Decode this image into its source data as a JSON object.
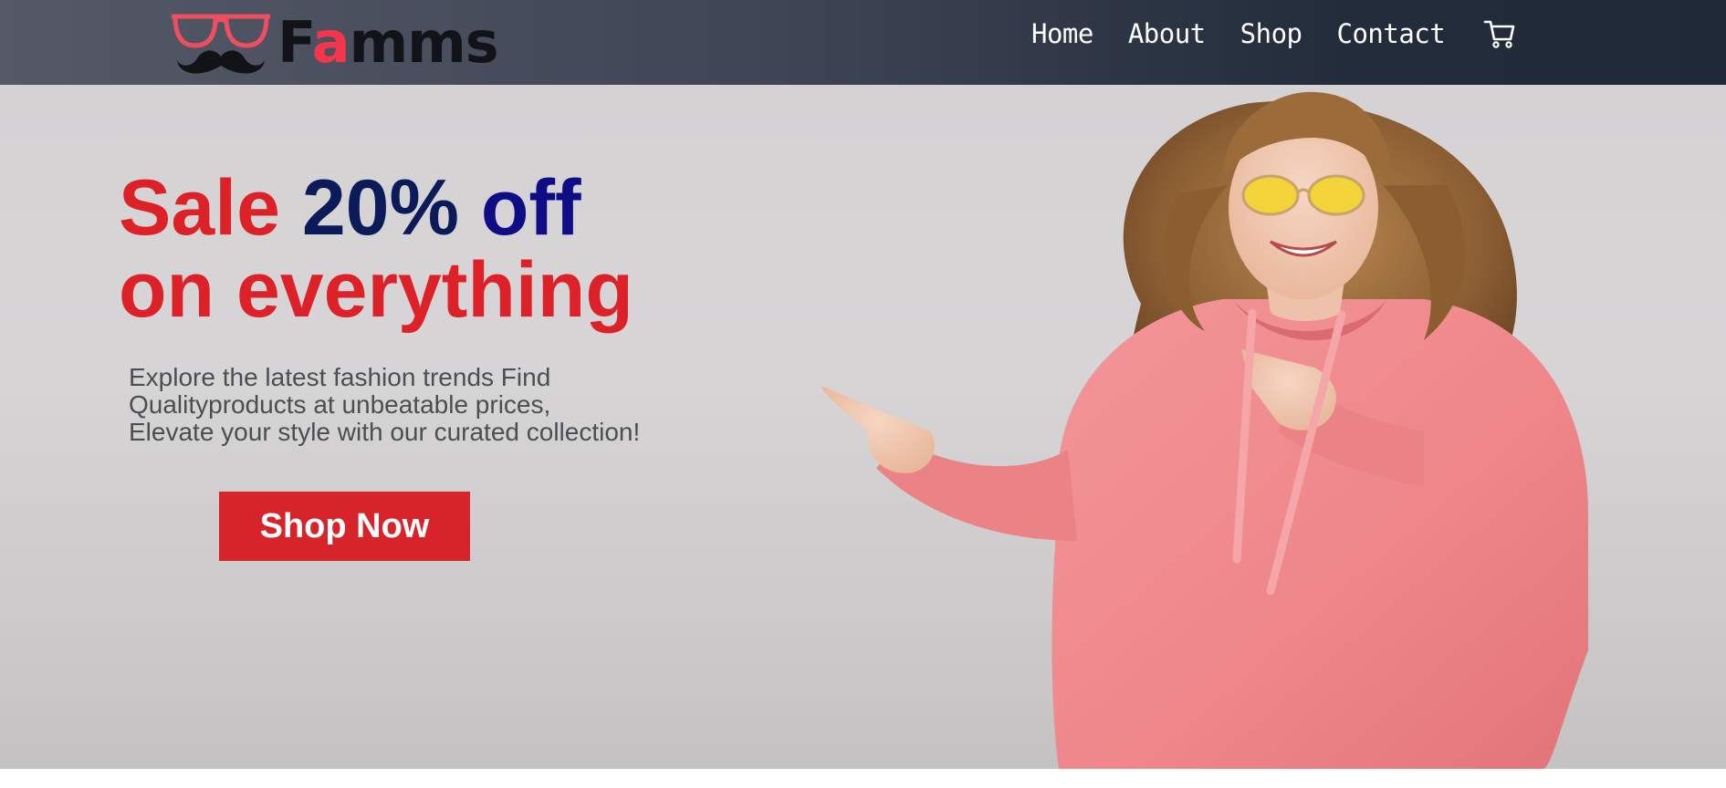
{
  "brand": {
    "name_first": "F",
    "name_accent": "a",
    "name_rest": "mms",
    "logo_icon": "glasses-mustache-icon",
    "accent_color": "#f4364c"
  },
  "nav": {
    "items": [
      {
        "label": "Home"
      },
      {
        "label": "About"
      },
      {
        "label": "Shop"
      },
      {
        "label": "Contact"
      }
    ],
    "cart_icon": "cart-icon"
  },
  "hero": {
    "title_word1": "Sale",
    "title_word2": "20%",
    "title_word3": "off",
    "title_line2": "on everything",
    "desc_line1": "Explore the latest fashion trends Find",
    "desc_line2": "Qualityproducts at unbeatable prices,",
    "desc_line3": "Elevate your style with our curated collection!",
    "cta_label": "Shop Now",
    "colors": {
      "red": "#dc2228",
      "navy": "#0b1b5a",
      "blue": "#0e0d86",
      "button": "#d6242a"
    },
    "image": "woman-in-pink-hoodie-pointing-photo"
  }
}
